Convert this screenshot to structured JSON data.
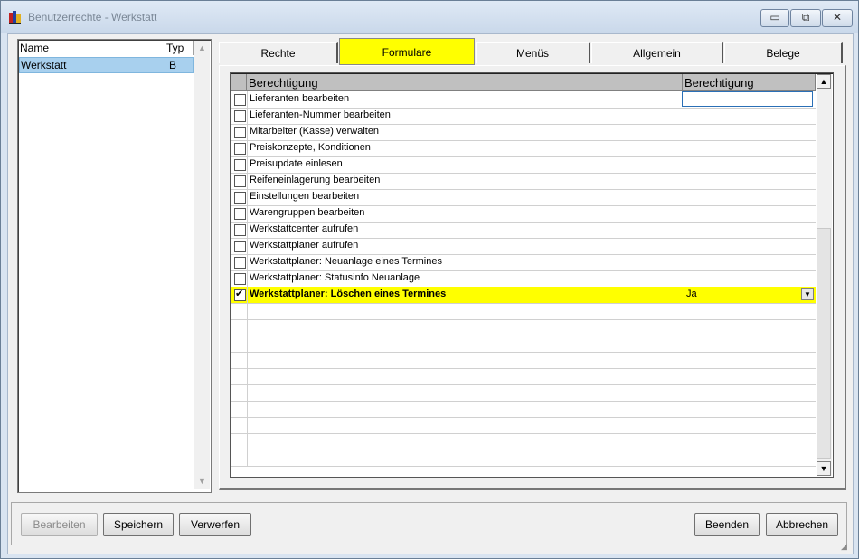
{
  "window": {
    "title": "Benutzerrechte - Werkstatt"
  },
  "user_list": {
    "columns": [
      "Name",
      "Typ"
    ],
    "rows": [
      {
        "name": "Werkstatt",
        "typ": "B"
      }
    ]
  },
  "tabs": [
    {
      "label": "Rechte",
      "active": false
    },
    {
      "label": "Formulare",
      "active": true
    },
    {
      "label": "Menüs",
      "active": false
    },
    {
      "label": "Allgemein",
      "active": false
    },
    {
      "label": "Belege",
      "active": false
    }
  ],
  "grid": {
    "columns": [
      "Berechtigung",
      "Berechtigung"
    ],
    "rows": [
      {
        "label": "Lieferanten bearbeiten",
        "checked": false,
        "value": ""
      },
      {
        "label": "Lieferanten-Nummer bearbeiten",
        "checked": false,
        "value": ""
      },
      {
        "label": "Mitarbeiter (Kasse) verwalten",
        "checked": false,
        "value": ""
      },
      {
        "label": "Preiskonzepte, Konditionen",
        "checked": false,
        "value": ""
      },
      {
        "label": "Preisupdate einlesen",
        "checked": false,
        "value": ""
      },
      {
        "label": "Reifeneinlagerung bearbeiten",
        "checked": false,
        "value": ""
      },
      {
        "label": "Einstellungen bearbeiten",
        "checked": false,
        "value": ""
      },
      {
        "label": "Warengruppen bearbeiten",
        "checked": false,
        "value": ""
      },
      {
        "label": "Werkstattcenter aufrufen",
        "checked": false,
        "value": ""
      },
      {
        "label": "Werkstattplaner aufrufen",
        "checked": false,
        "value": ""
      },
      {
        "label": "Werkstattplaner: Neuanlage eines Termines",
        "checked": false,
        "value": ""
      },
      {
        "label": "Werkstattplaner: Statusinfo Neuanlage",
        "checked": false,
        "value": ""
      },
      {
        "label": "Werkstattplaner: Löschen eines Termines",
        "checked": true,
        "value": "Ja",
        "selected": true
      }
    ]
  },
  "buttons": {
    "bearbeiten": "Bearbeiten",
    "speichern": "Speichern",
    "verwerfen": "Verwerfen",
    "beenden": "Beenden",
    "abbrechen": "Abbrechen"
  },
  "colors": {
    "active_tab": "#ffff00",
    "selected_row": "#ffff00",
    "list_selection": "#a8d0ee"
  }
}
